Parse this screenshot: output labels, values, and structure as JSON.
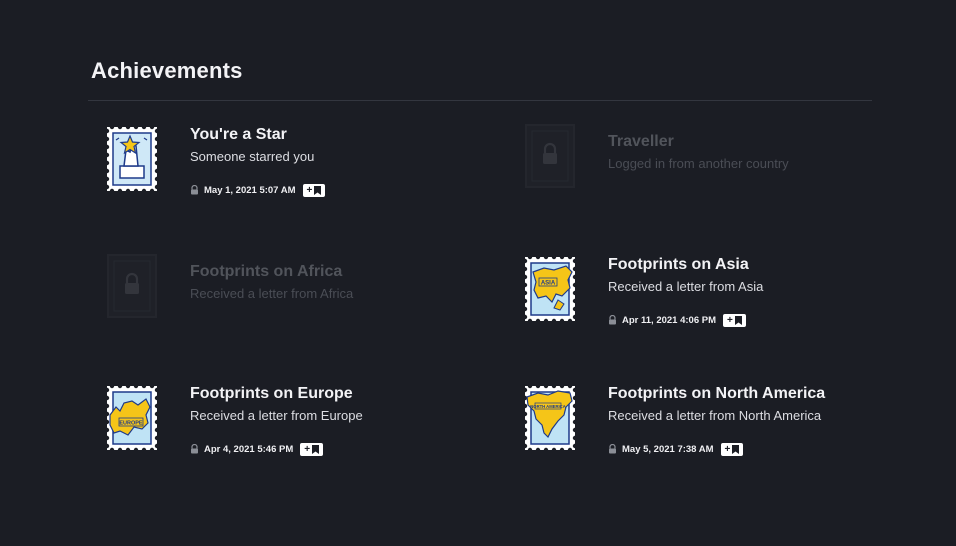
{
  "page": {
    "title": "Achievements"
  },
  "achievements": [
    {
      "name": "You're a Star",
      "description": "Someone starred you",
      "date": "May 1, 2021 5:07 AM",
      "unlocked": true,
      "icon": "star-stamp-icon"
    },
    {
      "name": "Traveller",
      "description": "Logged in from another country",
      "unlocked": false,
      "icon": "locked-stamp-icon"
    },
    {
      "name": "Footprints on Africa",
      "description": "Received a letter from Africa",
      "unlocked": false,
      "icon": "locked-stamp-icon"
    },
    {
      "name": "Footprints on Asia",
      "description": "Received a letter from Asia",
      "date": "Apr 11, 2021 4:06 PM",
      "unlocked": true,
      "icon": "asia-stamp-icon",
      "stamp_label": "ASIA"
    },
    {
      "name": "Footprints on Europe",
      "description": "Received a letter from Europe",
      "date": "Apr 4, 2021 5:46 PM",
      "unlocked": true,
      "icon": "europe-stamp-icon",
      "stamp_label": "EUROPE"
    },
    {
      "name": "Footprints on North America",
      "description": "Received a letter from North America",
      "date": "May 5, 2021 7:38 AM",
      "unlocked": true,
      "icon": "north-america-stamp-icon",
      "stamp_label": "NORTH AMERICA"
    }
  ],
  "pin_button": {
    "plus": "+",
    "icon": "bookmark-icon"
  },
  "colors": {
    "background": "#1b1d24",
    "stamp_yellow": "#f5c518",
    "stamp_blue": "#bfe3f5",
    "stamp_outline": "#1e3a8a"
  }
}
